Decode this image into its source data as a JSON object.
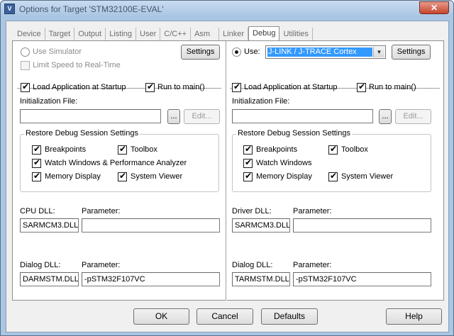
{
  "window": {
    "title": "Options for Target 'STM32100E-EVAL'",
    "close_glyph": "✕"
  },
  "tabs": [
    {
      "label": "Device"
    },
    {
      "label": "Target"
    },
    {
      "label": "Output"
    },
    {
      "label": "Listing"
    },
    {
      "label": "User"
    },
    {
      "label": "C/C++"
    },
    {
      "label": "Asm"
    },
    {
      "label": "Linker"
    },
    {
      "label": "Debug"
    },
    {
      "label": "Utilities"
    }
  ],
  "active_tab": "Debug",
  "left": {
    "use_simulator": "Use Simulator",
    "limit_speed": "Limit Speed to Real-Time",
    "settings": "Settings",
    "load_app": "Load Application at Startup",
    "run_to_main": "Run to main()",
    "init_file_label": "Initialization File:",
    "init_file_value": "",
    "browse": "...",
    "edit": "Edit...",
    "restore_group": "Restore Debug Session Settings",
    "breakpoints": "Breakpoints",
    "toolbox": "Toolbox",
    "watch_windows": "Watch Windows & Performance Analyzer",
    "memory_display": "Memory Display",
    "system_viewer": "System Viewer",
    "dll_label": "CPU DLL:",
    "dll_param_label": "Parameter:",
    "dll_value": "SARMCM3.DLL",
    "dll_param_value": "",
    "dialog_dll_label": "Dialog DLL:",
    "dialog_param_label": "Parameter:",
    "dialog_dll_value": "DARMSTM.DLL",
    "dialog_param_value": "-pSTM32F107VC"
  },
  "right": {
    "use": "Use:",
    "debugger": "J-LINK / J-TRACE Cortex",
    "settings": "Settings",
    "load_app": "Load Application at Startup",
    "run_to_main": "Run to main()",
    "init_file_label": "Initialization File:",
    "init_file_value": "",
    "browse": "...",
    "edit": "Edit...",
    "restore_group": "Restore Debug Session Settings",
    "breakpoints": "Breakpoints",
    "toolbox": "Toolbox",
    "watch_windows": "Watch Windows",
    "memory_display": "Memory Display",
    "system_viewer": "System Viewer",
    "dll_label": "Driver DLL:",
    "dll_param_label": "Parameter:",
    "dll_value": "SARMCM3.DLL",
    "dll_param_value": "",
    "dialog_dll_label": "Dialog DLL:",
    "dialog_param_label": "Parameter:",
    "dialog_dll_value": "TARMSTM.DLL",
    "dialog_param_value": "-pSTM32F107VC"
  },
  "buttons": {
    "ok": "OK",
    "cancel": "Cancel",
    "defaults": "Defaults",
    "help": "Help"
  }
}
